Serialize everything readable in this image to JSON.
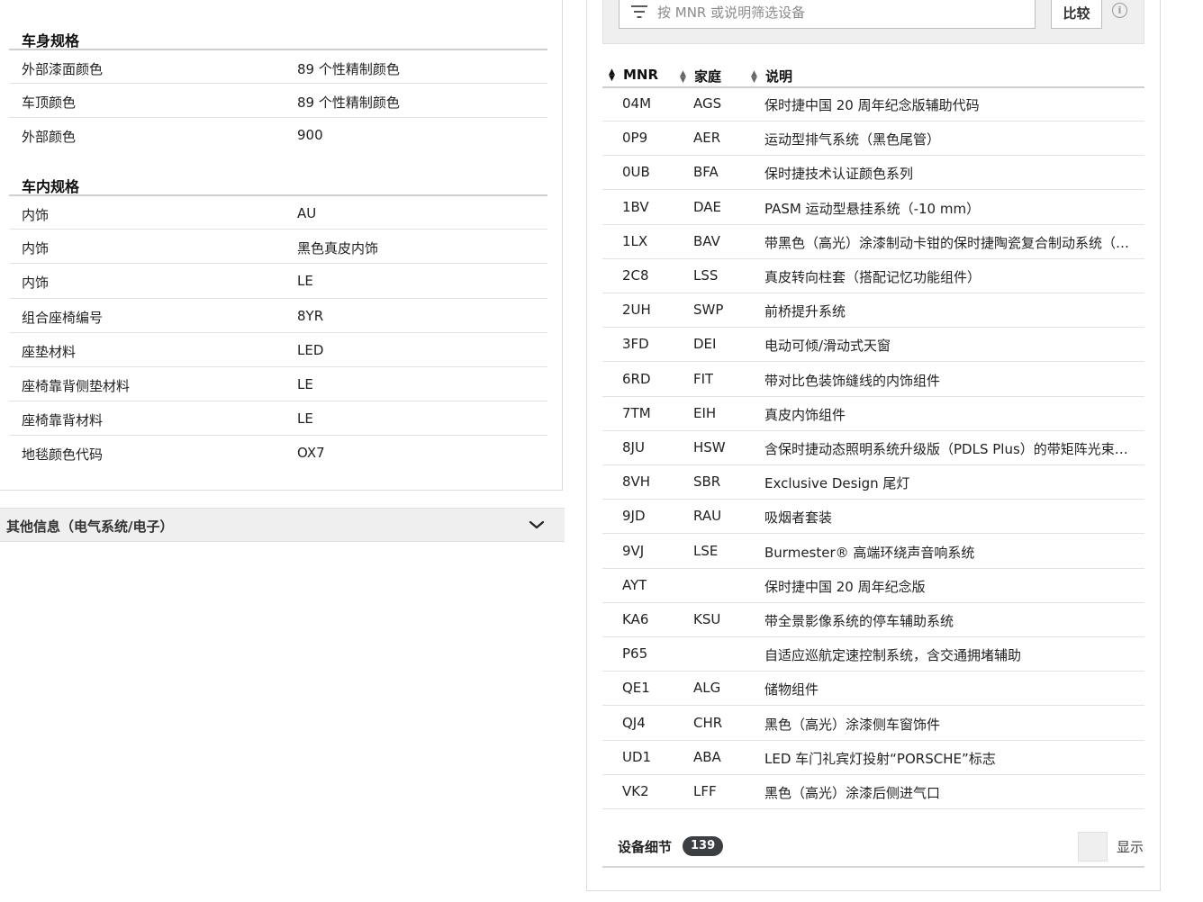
{
  "vehicle_specs": {
    "body_section": {
      "title": "车身规格",
      "rows": [
        {
          "label": "外部漆面颜色",
          "value": "89 个性精制颜色"
        },
        {
          "label": "车顶颜色",
          "value": "89 个性精制颜色"
        },
        {
          "label": "外部颜色",
          "value": "900"
        }
      ]
    },
    "interior_section": {
      "title": "车内规格",
      "rows": [
        {
          "label": "内饰",
          "value": "AU"
        },
        {
          "label": "内饰",
          "value": "黑色真皮内饰"
        },
        {
          "label": "内饰",
          "value": "LE"
        },
        {
          "label": "组合座椅编号",
          "value": "8YR"
        },
        {
          "label": "座垫材料",
          "value": "LED"
        },
        {
          "label": "座椅靠背侧垫材料",
          "value": "LE"
        },
        {
          "label": "座椅靠背材料",
          "value": "LE"
        },
        {
          "label": "地毯颜色代码",
          "value": "OX7"
        }
      ]
    },
    "other_info": {
      "label": "其他信息（电气系统/电子）",
      "icon": "chevron-down-icon"
    }
  },
  "equipment": {
    "filter": {
      "placeholder": "按 MNR 或说明筛选设备",
      "icon": "filter-icon"
    },
    "compare_label": "比较",
    "info_icon": "i",
    "columns": {
      "mnr": "MNR",
      "family": "家庭",
      "desc": "说明"
    },
    "rows": [
      {
        "mnr": "04M",
        "family": "AGS",
        "desc": "保时捷中国 20 周年纪念版辅助代码"
      },
      {
        "mnr": "0P9",
        "family": "AER",
        "desc": "运动型排气系统（黑色尾管）"
      },
      {
        "mnr": "0UB",
        "family": "BFA",
        "desc": "保时捷技术认证颜色系列"
      },
      {
        "mnr": "1BV",
        "family": "DAE",
        "desc": "PASM 运动型悬挂系统（-10 mm）"
      },
      {
        "mnr": "1LX",
        "family": "BAV",
        "desc": "带黑色（高光）涂漆制动卡钳的保时捷陶瓷复合制动系统（PC..."
      },
      {
        "mnr": "2C8",
        "family": "LSS",
        "desc": "真皮转向柱套（搭配记忆功能组件）"
      },
      {
        "mnr": "2UH",
        "family": "SWP",
        "desc": "前桥提升系统"
      },
      {
        "mnr": "3FD",
        "family": "DEI",
        "desc": "电动可倾/滑动式天窗"
      },
      {
        "mnr": "6RD",
        "family": "FIT",
        "desc": "带对比色装饰缝线的内饰组件"
      },
      {
        "mnr": "7TM",
        "family": "EIH",
        "desc": "真皮内饰组件"
      },
      {
        "mnr": "8JU",
        "family": "HSW",
        "desc": "含保时捷动态照明系统升级版（PDLS Plus）的带矩阵光束的..."
      },
      {
        "mnr": "8VH",
        "family": "SBR",
        "desc": "Exclusive Design 尾灯"
      },
      {
        "mnr": "9JD",
        "family": "RAU",
        "desc": "吸烟者套装"
      },
      {
        "mnr": "9VJ",
        "family": "LSE",
        "desc": "Burmester® 高端环绕声音响系统"
      },
      {
        "mnr": "AYT",
        "family": "",
        "desc": "保时捷中国 20 周年纪念版"
      },
      {
        "mnr": "KA6",
        "family": "KSU",
        "desc": "带全景影像系统的停车辅助系统"
      },
      {
        "mnr": "P65",
        "family": "",
        "desc": "自适应巡航定速控制系统，含交通拥堵辅助"
      },
      {
        "mnr": "QE1",
        "family": "ALG",
        "desc": "储物组件"
      },
      {
        "mnr": "QJ4",
        "family": "CHR",
        "desc": "黑色（高光）涂漆侧车窗饰件"
      },
      {
        "mnr": "UD1",
        "family": "ABA",
        "desc": "LED 车门礼宾灯投射“PORSCHE”标志"
      },
      {
        "mnr": "VK2",
        "family": "LFF",
        "desc": "黑色（高光）涂漆后侧进气口"
      }
    ],
    "footer": {
      "label": "设备细节",
      "count": "139",
      "show_label": "显示"
    }
  }
}
